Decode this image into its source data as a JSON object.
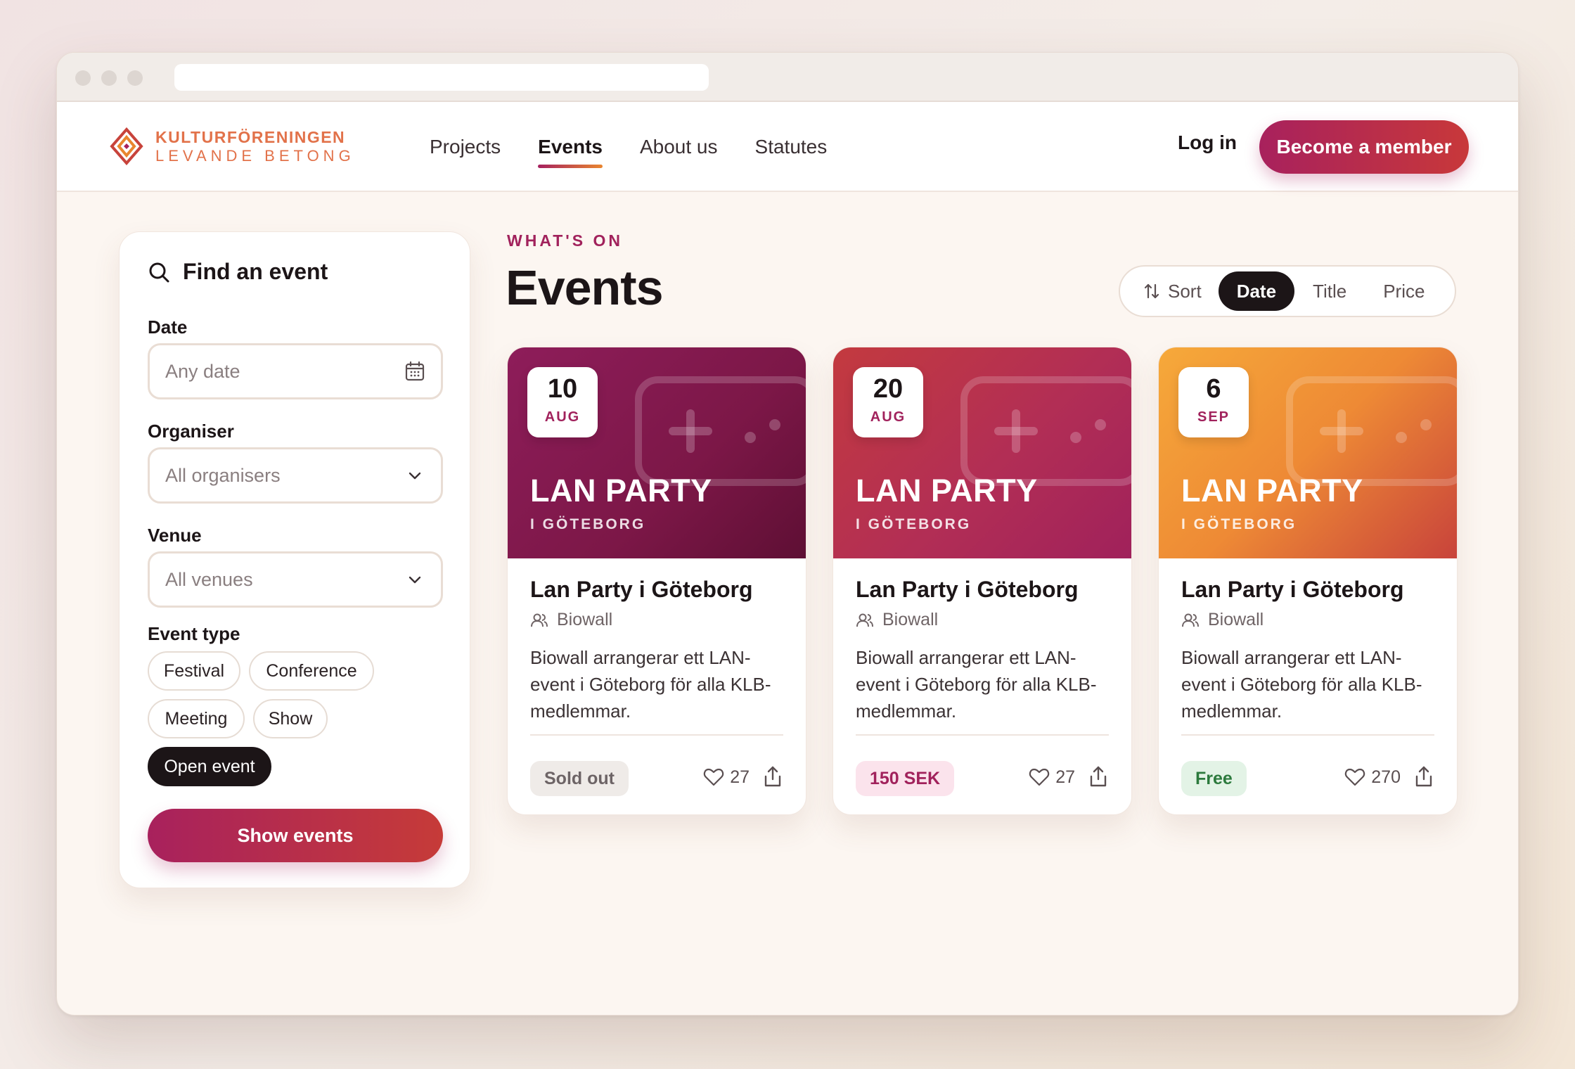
{
  "brand": {
    "line1": "KULTURFÖRENINGEN",
    "line2": "LEVANDE BETONG",
    "accent": "#e2724a"
  },
  "nav": {
    "items": [
      {
        "label": "Projects",
        "active": false
      },
      {
        "label": "Events",
        "active": true
      },
      {
        "label": "About us",
        "active": false
      },
      {
        "label": "Statutes",
        "active": false
      }
    ],
    "login_label": "Log in",
    "cta_label": "Become a member"
  },
  "sidebar": {
    "title": "Find an event",
    "date_label": "Date",
    "date_value": "Any date",
    "organiser_label": "Organiser",
    "organiser_value": "All organisers",
    "venue_label": "Venue",
    "venue_value": "All venues",
    "type_label": "Event type",
    "types": [
      {
        "label": "Festival",
        "selected": false
      },
      {
        "label": "Conference",
        "selected": false
      },
      {
        "label": "Meeting",
        "selected": false
      },
      {
        "label": "Show",
        "selected": false
      },
      {
        "label": "Open event",
        "selected": true
      }
    ],
    "submit_label": "Show events"
  },
  "main": {
    "kicker": "WHAT'S ON",
    "title": "Events",
    "sort": {
      "label": "Sort",
      "options": [
        {
          "label": "Date",
          "selected": true
        },
        {
          "label": "Title",
          "selected": false
        },
        {
          "label": "Price",
          "selected": false
        }
      ]
    },
    "events": [
      {
        "day": "10",
        "month": "AUG",
        "banner_title": "LAN PARTY",
        "banner_sub": "I GÖTEBORG",
        "title": "Lan Party i Göteborg",
        "organiser": "Biowall",
        "description": "Biowall arrangerar ett LAN-event i Göteborg för alla KLB-medlemmar.",
        "price": "Sold out",
        "price_kind": "sold",
        "likes": "27"
      },
      {
        "day": "20",
        "month": "AUG",
        "banner_title": "LAN PARTY",
        "banner_sub": "I GÖTEBORG",
        "title": "Lan Party i Göteborg",
        "organiser": "Biowall",
        "description": "Biowall arrangerar ett LAN-event i Göteborg för alla KLB-medlemmar.",
        "price": "150 SEK",
        "price_kind": "paid",
        "likes": "27"
      },
      {
        "day": "6",
        "month": "SEP",
        "banner_title": "LAN PARTY",
        "banner_sub": "I GÖTEBORG",
        "title": "Lan Party i Göteborg",
        "organiser": "Biowall",
        "description": "Biowall arrangerar ett LAN-event i Göteborg för alla KLB-medlemmar.",
        "price": "Free",
        "price_kind": "free",
        "likes": "270"
      }
    ]
  },
  "colors": {
    "primary": "#a8215d",
    "dark": "#1c1517",
    "background": "#fcf6f1"
  }
}
